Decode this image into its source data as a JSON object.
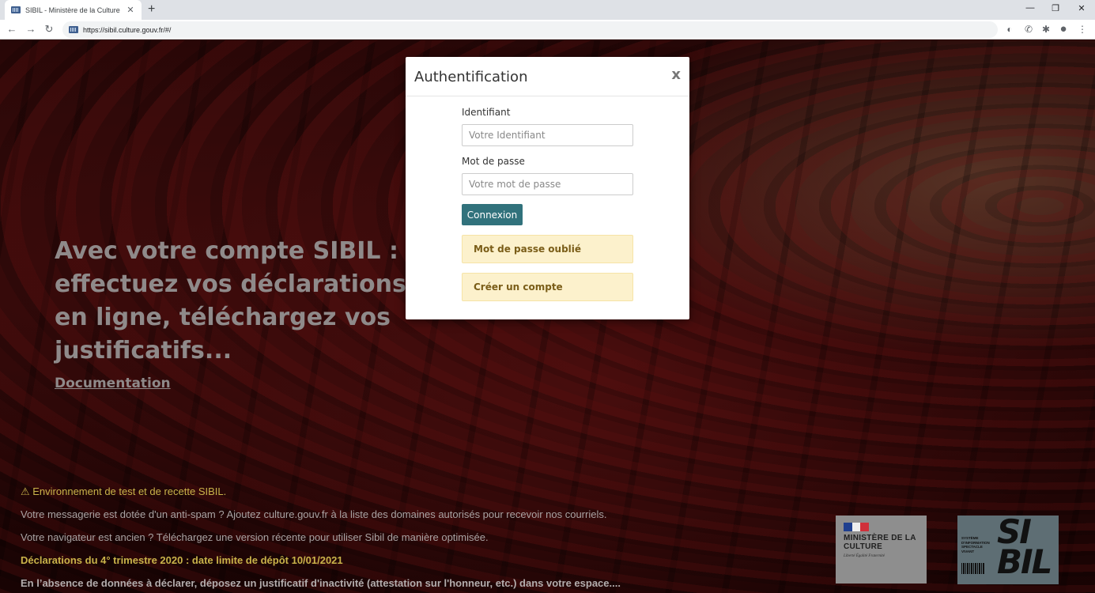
{
  "browser": {
    "tab_title": "SIBIL - Ministère de la Culture",
    "tab_close": "✕",
    "new_tab": "+",
    "window_controls": {
      "minimize": "—",
      "restore": "❐",
      "close": "✕"
    },
    "url": "https://sibil.culture.gouv.fr/#/",
    "nav": {
      "back": "←",
      "forward": "→",
      "reload": "↻"
    },
    "extensions": {
      "ext1": "◐",
      "ext2": "✆",
      "puzzle": "✱",
      "account": "●",
      "menu": "⋮"
    }
  },
  "hero": {
    "headline": "Avec votre compte SIBIL : effectuez vos déclarations en ligne, téléchargez vos justificatifs...",
    "documentation_link": "Documentation"
  },
  "notices": {
    "test_env": "⚠ Environnement de test et de recette SIBIL.",
    "antispam": "Votre messagerie est dotée d'un anti-spam ? Ajoutez culture.gouv.fr à la liste des domaines autorisés pour recevoir nos courriels.",
    "old_browser": "Votre navigateur est ancien ? Téléchargez une version récente pour utiliser Sibil de manière optimisée.",
    "deadline": "Déclarations du 4° trimestre 2020 : date limite de dépôt 10/01/2021",
    "inactivity": "En l’absence de données à déclarer, déposez un justificatif d'inactivité (attestation sur l'honneur, etc.) dans votre espace...."
  },
  "logos": {
    "ministere_name": "MINISTÈRE DE LA CULTURE",
    "ministere_motto": "Liberté Égalité Fraternité",
    "sibil_sub": "SYSTÈME D'INFORMATION SPECTACLE VIVANT",
    "sibil_big": "SI BIL"
  },
  "modal": {
    "title": "Authentification",
    "close": "x",
    "identifiant_label": "Identifiant",
    "identifiant_placeholder": "Votre Identifiant",
    "password_label": "Mot de passe",
    "password_placeholder": "Votre mot de passe",
    "connect_button": "Connexion",
    "forgot_password": "Mot de passe oublié",
    "create_account": "Créer un compte"
  },
  "colors": {
    "primary_button": "#31727c",
    "alert_bg": "#fcf1cc",
    "alert_text": "#7a5d18",
    "warning_text": "#c9b34a"
  }
}
